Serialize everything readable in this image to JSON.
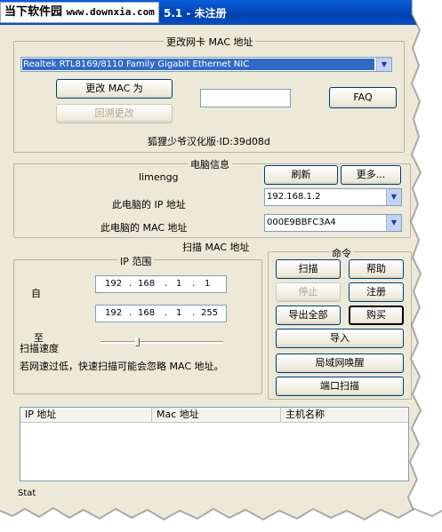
{
  "window": {
    "watermark_title": "当下软件园",
    "watermark_site": "www.downxia.com",
    "title_suffix": "5.1 - 未注册"
  },
  "mac_section": {
    "caption": "更改网卡 MAC 地址",
    "adapter": "Realtek RTL8169/8110 Family Gigabit Ethernet NIC",
    "change_button": "更改 MAC 为",
    "restore_button": "回溯更改",
    "faq_button": "FAQ",
    "new_mac_value": "",
    "version_text": "狐狸少爷汉化版·ID:39d08d"
  },
  "computer_info": {
    "caption": "电脑信息",
    "computer_name": "limengg",
    "refresh_button": "刷新",
    "more_button": "更多...",
    "ip_label": "此电脑的 IP 地址",
    "ip_value": "192.168.1.2",
    "mac_label": "此电脑的 MAC 地址",
    "mac_value": "000E9BBFC3A4"
  },
  "scan": {
    "caption": "扫描 MAC 地址",
    "ip_range_caption": "IP 范围",
    "from_label": "自",
    "to_label": "至",
    "from_ip": [
      "192",
      "168",
      "1",
      "1"
    ],
    "to_ip": [
      "192",
      "168",
      "1",
      "255"
    ],
    "speed_label": "扫描速度",
    "speed_level": 0.3,
    "warning": "若网速过低，快速扫描可能会忽略 MAC 地址。"
  },
  "commands": {
    "caption": "命令",
    "scan": "扫描",
    "help": "帮助",
    "stop": "停止",
    "register": "注册",
    "export_all": "导出全部",
    "buy": "购买",
    "import": "导入",
    "lan_wake": "局域网唤醒",
    "port_scan": "端口扫描"
  },
  "results": {
    "columns": [
      "IP 地址",
      "Mac 地址",
      "主机名称"
    ]
  },
  "status": {
    "text": "Stat"
  }
}
